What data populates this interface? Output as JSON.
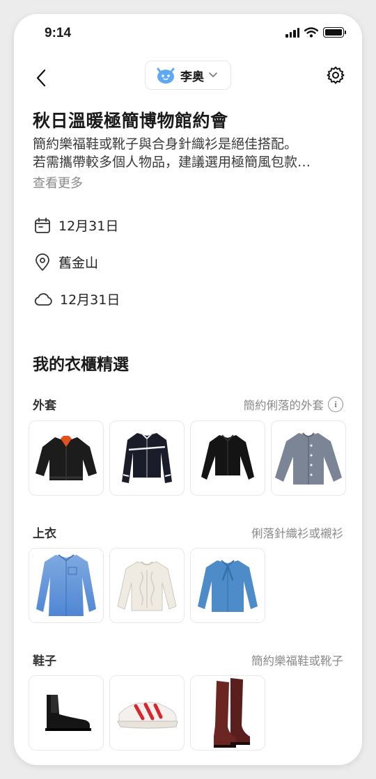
{
  "status_bar": {
    "time": "9:14"
  },
  "header": {
    "user_name": "李奥"
  },
  "outing": {
    "title": "秋日溫暖極簡博物館約會",
    "description_lines": [
      "簡約樂福鞋或靴子與合身針織衫是絕佳搭配。",
      "若需攜帶較多個人物品，建議選用極簡風包款…"
    ],
    "see_more": "查看更多",
    "date": "12月31日",
    "location": "舊金山",
    "weather": "12月31日"
  },
  "wardrobe": {
    "title": "我的衣櫃精選",
    "categories": [
      {
        "name": "外套",
        "hint": "簡約俐落的外套",
        "items": [
          "black-bomber-jacket",
          "black-track-jacket",
          "black-cropped-jacket",
          "gray-cardigan"
        ]
      },
      {
        "name": "上衣",
        "hint": "俐落針織衫或襯衫",
        "items": [
          "blue-oversized-shirt",
          "cream-cable-knit-sweater",
          "blue-tie-neck-blouse"
        ]
      },
      {
        "name": "鞋子",
        "hint": "簡約樂福鞋或靴子",
        "items": [
          "black-chelsea-boots",
          "red-white-running-sneakers",
          "brown-knee-high-boots"
        ]
      }
    ]
  },
  "colors": {
    "accent_avatar": "#5ea9f0",
    "text_primary": "#1a1a1a",
    "text_secondary": "#8b8b8b"
  }
}
